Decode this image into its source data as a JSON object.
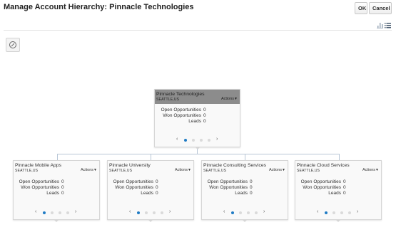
{
  "header": {
    "title": "Manage Account Hierarchy: Pinnacle Technologies",
    "ok_label": "OK",
    "cancel_label": "Cancel"
  },
  "toolbar": {
    "icons": [
      "hierarchy-view-icon",
      "list-view-icon"
    ]
  },
  "colors": {
    "accent": "#1f7bc4",
    "root_header": "#8c8c8c",
    "connector": "#b8c6d6"
  },
  "root": {
    "name": "Pinnacle Technologies",
    "location": "SEATTLE,US",
    "actions_label": "Actions",
    "metrics": [
      {
        "label": "Open Opportunities",
        "value": "0"
      },
      {
        "label": "Won Opportunities",
        "value": "0"
      },
      {
        "label": "Leads",
        "value": "0"
      }
    ]
  },
  "children": [
    {
      "name": "Pinnacle Mobile Apps",
      "location": "SEATTLE,US",
      "actions_label": "Actions",
      "metrics": [
        {
          "label": "Open Opportunities",
          "value": "0"
        },
        {
          "label": "Won Opportunities",
          "value": "0"
        },
        {
          "label": "Leads",
          "value": "0"
        }
      ]
    },
    {
      "name": "Pinnacle University",
      "location": "SEATTLE,US",
      "actions_label": "Actions",
      "metrics": [
        {
          "label": "Open Opportunities",
          "value": "0"
        },
        {
          "label": "Won Opportunities",
          "value": "0"
        },
        {
          "label": "Leads",
          "value": "0"
        }
      ]
    },
    {
      "name": "Pinnacle Consulting Services",
      "location": "SEATTLE,US",
      "actions_label": "Actions",
      "metrics": [
        {
          "label": "Open Opportunities",
          "value": "0"
        },
        {
          "label": "Won Opportunities",
          "value": "0"
        },
        {
          "label": "Leads",
          "value": "0"
        }
      ]
    },
    {
      "name": "Pinnacle Cloud Services",
      "location": "SEATTLE,US",
      "actions_label": "Actions",
      "metrics": [
        {
          "label": "Open Opportunities",
          "value": "0"
        },
        {
          "label": "Won Opportunities",
          "value": "0"
        },
        {
          "label": "Leads",
          "value": "0"
        }
      ]
    }
  ]
}
